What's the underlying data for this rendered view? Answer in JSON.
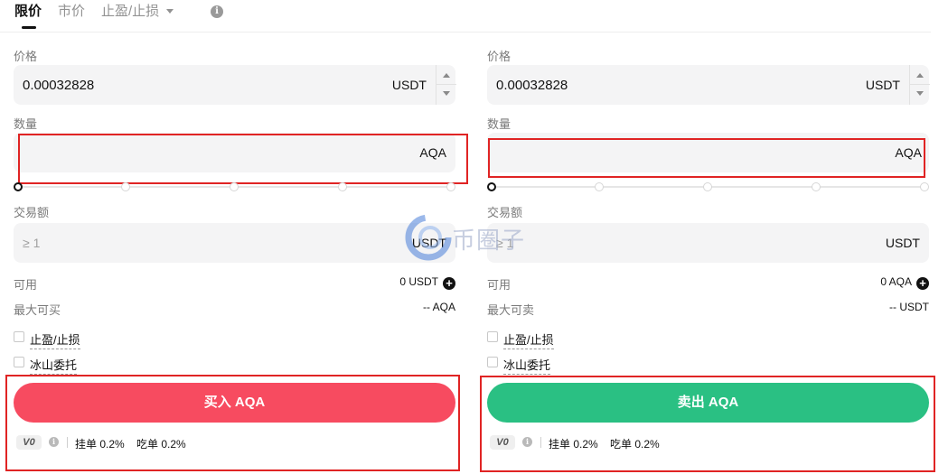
{
  "tabs": {
    "limit": "限价",
    "market": "市价",
    "stop": "止盈/止损"
  },
  "buy": {
    "price_label": "价格",
    "price_value": "0.00032828",
    "price_unit": "USDT",
    "amount_label": "数量",
    "amount_unit": "AQA",
    "total_label": "交易额",
    "total_placeholder": "≥ 1",
    "total_unit": "USDT",
    "available_label": "可用",
    "available_value": "0 USDT",
    "max_label": "最大可买",
    "max_value": "-- AQA",
    "tpsl_label": "止盈/止损",
    "iceberg_label": "冰山委托",
    "action_label": "买入 AQA",
    "vip": "V0",
    "maker": "挂单 0.2%",
    "taker": "吃单 0.2%"
  },
  "sell": {
    "price_label": "价格",
    "price_value": "0.00032828",
    "price_unit": "USDT",
    "amount_label": "数量",
    "amount_unit": "AQA",
    "total_label": "交易额",
    "total_placeholder": "≥ 1",
    "total_unit": "USDT",
    "available_label": "可用",
    "available_value": "0 AQA",
    "max_label": "最大可卖",
    "max_value": "-- USDT",
    "tpsl_label": "止盈/止损",
    "iceberg_label": "冰山委托",
    "action_label": "卖出 AQA",
    "vip": "V0",
    "maker": "挂单 0.2%",
    "taker": "吃单 0.2%"
  },
  "watermark": "币圈子",
  "colors": {
    "buy": "#f74b60",
    "sell": "#2ac083",
    "highlight": "#e02424"
  }
}
